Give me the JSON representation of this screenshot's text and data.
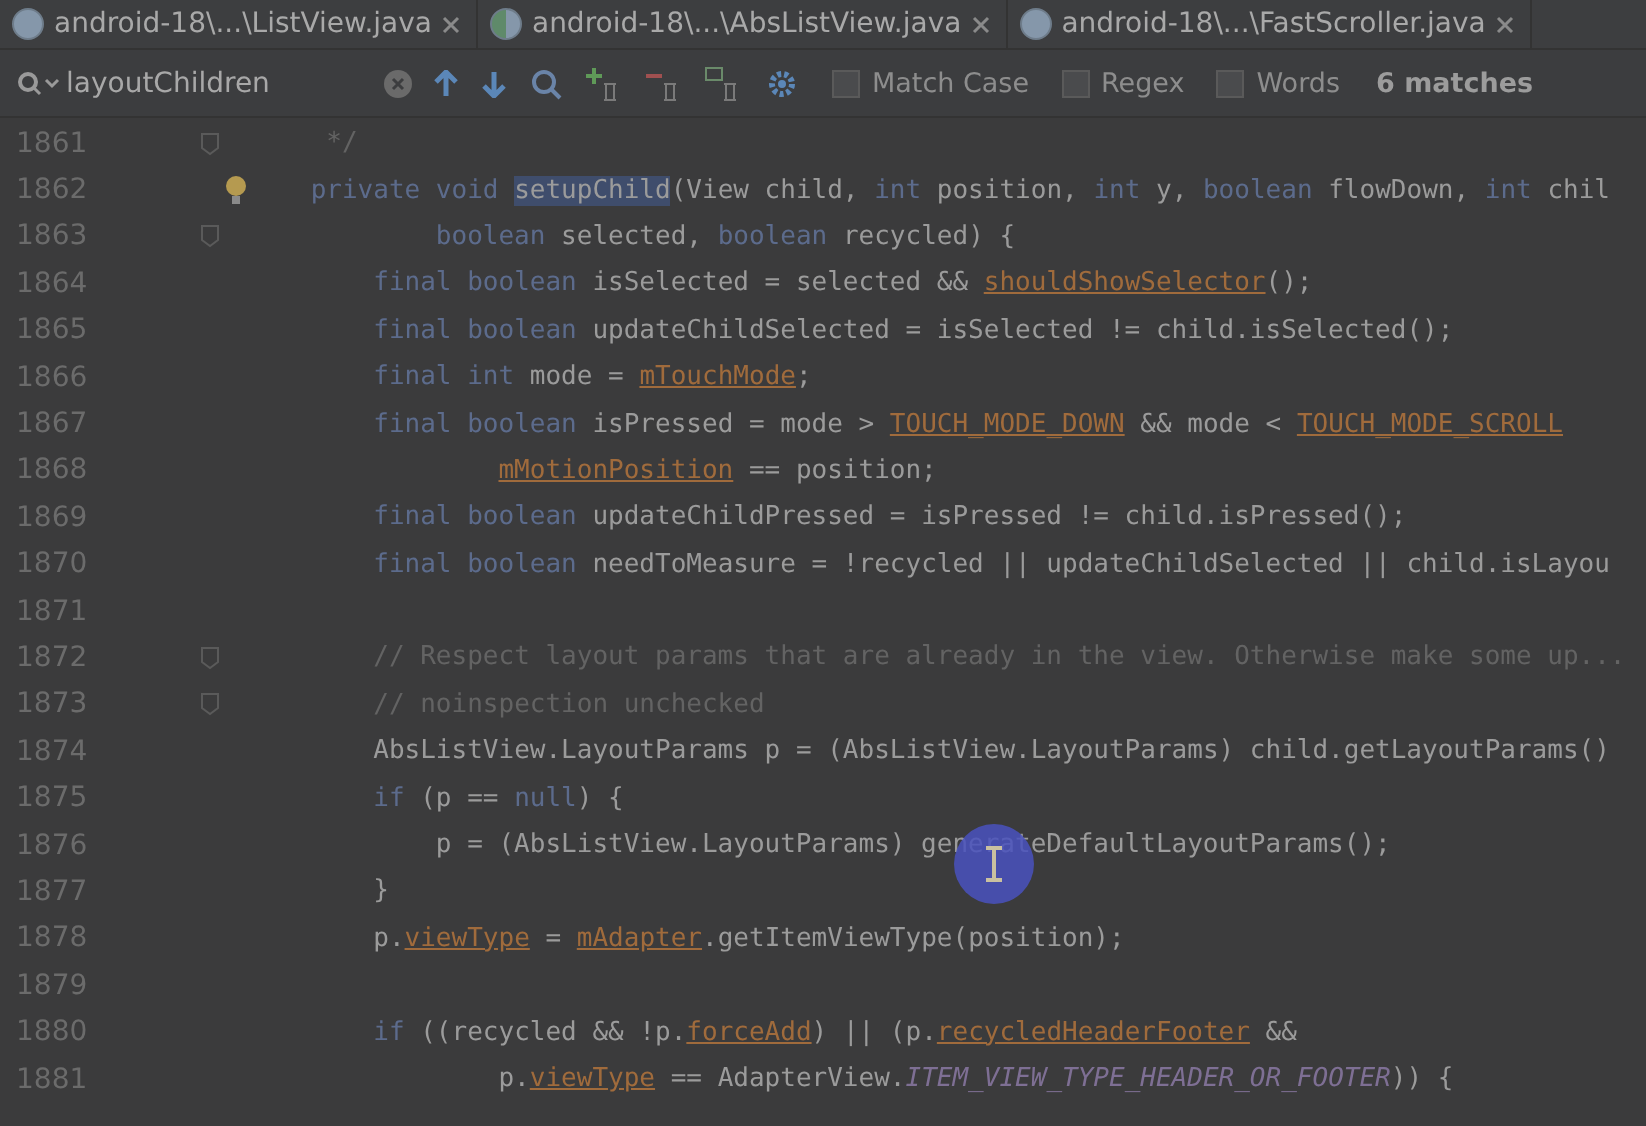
{
  "tabs": [
    {
      "label": "android-18\\...\\ListView.java",
      "kind": "class"
    },
    {
      "label": "android-18\\...\\AbsListView.java",
      "kind": "abstract"
    },
    {
      "label": "android-18\\...\\FastScroller.java",
      "kind": "class"
    }
  ],
  "find_bar": {
    "query": "layoutChildren",
    "options": [
      {
        "label": "Match Case",
        "checked": false
      },
      {
        "label": "Regex",
        "checked": false
      },
      {
        "label": "Words",
        "checked": false
      }
    ],
    "matches": "6 matches"
  },
  "editor": {
    "lines": [
      {
        "number": "1861",
        "fold": true,
        "intention": false,
        "tokens": [
          {
            "kind": "comment",
            "text": "     */"
          }
        ]
      },
      {
        "number": "1862",
        "fold": false,
        "intention": true,
        "tokens": [
          {
            "kind": "keyword",
            "text": "    private void "
          },
          {
            "kind": "match",
            "text": "setupChild"
          },
          {
            "kind": "plain",
            "text": "(View child, "
          },
          {
            "kind": "keyword",
            "text": "int "
          },
          {
            "kind": "plain",
            "text": "position, "
          },
          {
            "kind": "keyword",
            "text": "int "
          },
          {
            "kind": "plain",
            "text": "y, "
          },
          {
            "kind": "keyword",
            "text": "boolean "
          },
          {
            "kind": "plain",
            "text": "flowDown, "
          },
          {
            "kind": "keyword",
            "text": "int "
          },
          {
            "kind": "plain",
            "text": "chil"
          }
        ]
      },
      {
        "number": "1863",
        "fold": true,
        "intention": false,
        "tokens": [
          {
            "kind": "keyword",
            "text": "            boolean "
          },
          {
            "kind": "plain",
            "text": "selected, "
          },
          {
            "kind": "keyword",
            "text": "boolean "
          },
          {
            "kind": "plain",
            "text": "recycled) {"
          }
        ]
      },
      {
        "number": "1864",
        "fold": false,
        "intention": false,
        "tokens": [
          {
            "kind": "keyword",
            "text": "        final boolean "
          },
          {
            "kind": "plain",
            "text": "isSelected = selected && "
          },
          {
            "kind": "field",
            "text": "shouldShowSelector"
          },
          {
            "kind": "plain",
            "text": "();"
          }
        ]
      },
      {
        "number": "1865",
        "fold": false,
        "intention": false,
        "tokens": [
          {
            "kind": "keyword",
            "text": "        final boolean "
          },
          {
            "kind": "plain",
            "text": "updateChildSelected = isSelected != child.isSelected();"
          }
        ]
      },
      {
        "number": "1866",
        "fold": false,
        "intention": false,
        "tokens": [
          {
            "kind": "keyword",
            "text": "        final int "
          },
          {
            "kind": "plain",
            "text": "mode = "
          },
          {
            "kind": "field",
            "text": "mTouchMode"
          },
          {
            "kind": "plain",
            "text": ";"
          }
        ]
      },
      {
        "number": "1867",
        "fold": false,
        "intention": false,
        "tokens": [
          {
            "kind": "keyword",
            "text": "        final boolean "
          },
          {
            "kind": "plain",
            "text": "isPressed = mode > "
          },
          {
            "kind": "field",
            "text": "TOUCH_MODE_DOWN"
          },
          {
            "kind": "plain",
            "text": " && mode < "
          },
          {
            "kind": "field",
            "text": "TOUCH_MODE_SCROLL"
          }
        ]
      },
      {
        "number": "1868",
        "fold": false,
        "intention": false,
        "tokens": [
          {
            "kind": "field",
            "text": "                mMotionPosition"
          },
          {
            "kind": "plain",
            "text": " == position;"
          }
        ]
      },
      {
        "number": "1869",
        "fold": false,
        "intention": false,
        "tokens": [
          {
            "kind": "keyword",
            "text": "        final boolean "
          },
          {
            "kind": "plain",
            "text": "updateChildPressed = isPressed != child.isPressed();"
          }
        ]
      },
      {
        "number": "1870",
        "fold": false,
        "intention": false,
        "tokens": [
          {
            "kind": "keyword",
            "text": "        final boolean "
          },
          {
            "kind": "plain",
            "text": "needToMeasure = !recycled || updateChildSelected || child.isLayou"
          }
        ]
      },
      {
        "number": "1871",
        "fold": false,
        "intention": false
      },
      {
        "number": "1872",
        "fold": true,
        "intention": false,
        "tokens": [
          {
            "kind": "comment",
            "text": "        // Respect layout params that are already in the view. Otherwise make some up..."
          }
        ]
      },
      {
        "number": "1873",
        "fold": true,
        "intention": false,
        "tokens": [
          {
            "kind": "comment",
            "text": "        // noinspection unchecked"
          }
        ]
      },
      {
        "number": "1874",
        "fold": false,
        "intention": false,
        "tokens": [
          {
            "kind": "plain",
            "text": "        AbsListView.LayoutParams p = (AbsListView.LayoutParams) child.getLayoutParams()"
          }
        ]
      },
      {
        "number": "1875",
        "fold": false,
        "intention": false,
        "tokens": [
          {
            "kind": "keyword",
            "text": "        if "
          },
          {
            "kind": "plain",
            "text": "(p == "
          },
          {
            "kind": "keyword",
            "text": "null"
          },
          {
            "kind": "plain",
            "text": ") {"
          }
        ]
      },
      {
        "number": "1876",
        "fold": false,
        "intention": false,
        "tokens": [
          {
            "kind": "plain",
            "text": "            p = (AbsListView.LayoutParams) generateDefaultLayoutParams();"
          }
        ]
      },
      {
        "number": "1877",
        "fold": false,
        "intention": false,
        "tokens": [
          {
            "kind": "plain",
            "text": "        }"
          }
        ]
      },
      {
        "number": "1878",
        "fold": false,
        "intention": false,
        "tokens": [
          {
            "kind": "plain",
            "text": "        p."
          },
          {
            "kind": "field",
            "text": "viewType"
          },
          {
            "kind": "plain",
            "text": " = "
          },
          {
            "kind": "field",
            "text": "mAdapter"
          },
          {
            "kind": "plain",
            "text": ".getItemViewType(position);"
          }
        ]
      },
      {
        "number": "1879",
        "fold": false,
        "intention": false
      },
      {
        "number": "1880",
        "fold": false,
        "intention": false,
        "tokens": [
          {
            "kind": "keyword",
            "text": "        if "
          },
          {
            "kind": "plain",
            "text": "((recycled && !p."
          },
          {
            "kind": "field",
            "text": "forceAdd"
          },
          {
            "kind": "plain",
            "text": ") || (p."
          },
          {
            "kind": "field",
            "text": "recycledHeaderFooter"
          },
          {
            "kind": "plain",
            "text": " &&"
          }
        ]
      },
      {
        "number": "1881",
        "fold": false,
        "intention": false,
        "tokens": [
          {
            "kind": "plain",
            "text": "                p."
          },
          {
            "kind": "field",
            "text": "viewType"
          },
          {
            "kind": "plain",
            "text": " == AdapterView."
          },
          {
            "kind": "static",
            "text": "ITEM_VIEW_TYPE_HEADER_OR_FOOTER"
          },
          {
            "kind": "plain",
            "text": ")) {"
          }
        ]
      }
    ]
  }
}
